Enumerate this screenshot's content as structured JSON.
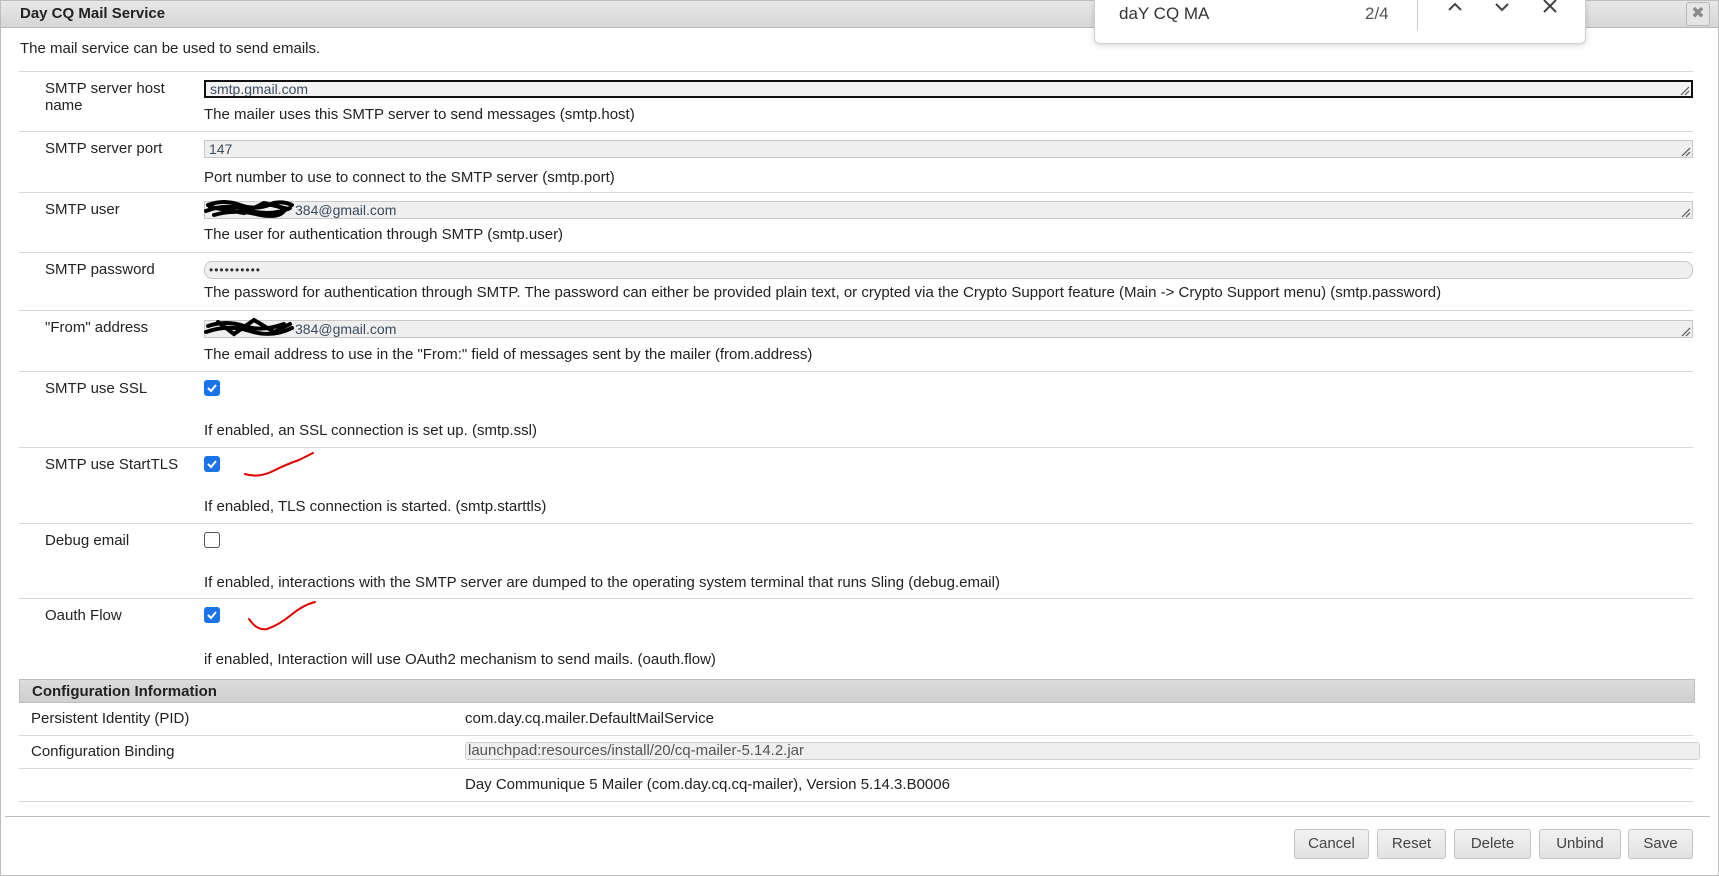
{
  "dialog": {
    "title": "Day CQ Mail Service",
    "description": "The mail service can be used to send emails.",
    "close_glyph": "✖"
  },
  "fields": {
    "smtp_host": {
      "label": "SMTP server host name",
      "value": "smtp.gmail.com",
      "help": "The mailer uses this SMTP server to send messages (smtp.host)"
    },
    "smtp_port": {
      "label": "SMTP server port",
      "value": "147",
      "help": "Port number to use to connect to the SMTP server (smtp.port)"
    },
    "smtp_user": {
      "label": "SMTP user",
      "value": "384@gmail.com",
      "help": "The user for authentication through SMTP (smtp.user)"
    },
    "smtp_password": {
      "label": "SMTP password",
      "value": "••••••••••",
      "help": "The password for authentication through SMTP. The password can either be provided plain text, or crypted via the Crypto Support feature (Main -> Crypto Support menu) (smtp.password)"
    },
    "from_address": {
      "label": "\"From\" address",
      "value": "384@gmail.com",
      "help": "The email address to use in the \"From:\" field of messages sent by the mailer (from.address)"
    },
    "smtp_ssl": {
      "label": "SMTP use SSL",
      "checked": true,
      "help": "If enabled, an SSL connection is set up. (smtp.ssl)"
    },
    "smtp_starttls": {
      "label": "SMTP use StartTLS",
      "checked": true,
      "help": "If enabled, TLS connection is started. (smtp.starttls)"
    },
    "debug_email": {
      "label": "Debug email",
      "checked": false,
      "help": "If enabled, interactions with the SMTP server are dumped to the operating system terminal that runs Sling (debug.email)"
    },
    "oauth_flow": {
      "label": "Oauth Flow",
      "checked": true,
      "help": "if enabled, Interaction will use OAuth2 mechanism to send mails. (oauth.flow)"
    }
  },
  "config_info": {
    "heading": "Configuration Information",
    "pid_label": "Persistent Identity (PID)",
    "pid_value": "com.day.cq.mailer.DefaultMailService",
    "binding_label": "Configuration Binding",
    "binding_value": "launchpad:resources/install/20/cq-mailer-5.14.2.jar",
    "bundle_info": "Day Communique 5 Mailer (com.day.cq.cq-mailer), Version 5.14.3.B0006"
  },
  "buttons": {
    "cancel": "Cancel",
    "reset": "Reset",
    "delete": "Delete",
    "unbind": "Unbind",
    "save": "Save"
  },
  "find_bar": {
    "query": "daY CQ MA",
    "count": "2/4",
    "icons": [
      "chevron-up-icon",
      "chevron-down-icon",
      "close-icon"
    ]
  },
  "colors": {
    "checkbox_checked": "#1a73e8",
    "annotation_ink": "#e00000",
    "redaction_ink": "#000000"
  }
}
